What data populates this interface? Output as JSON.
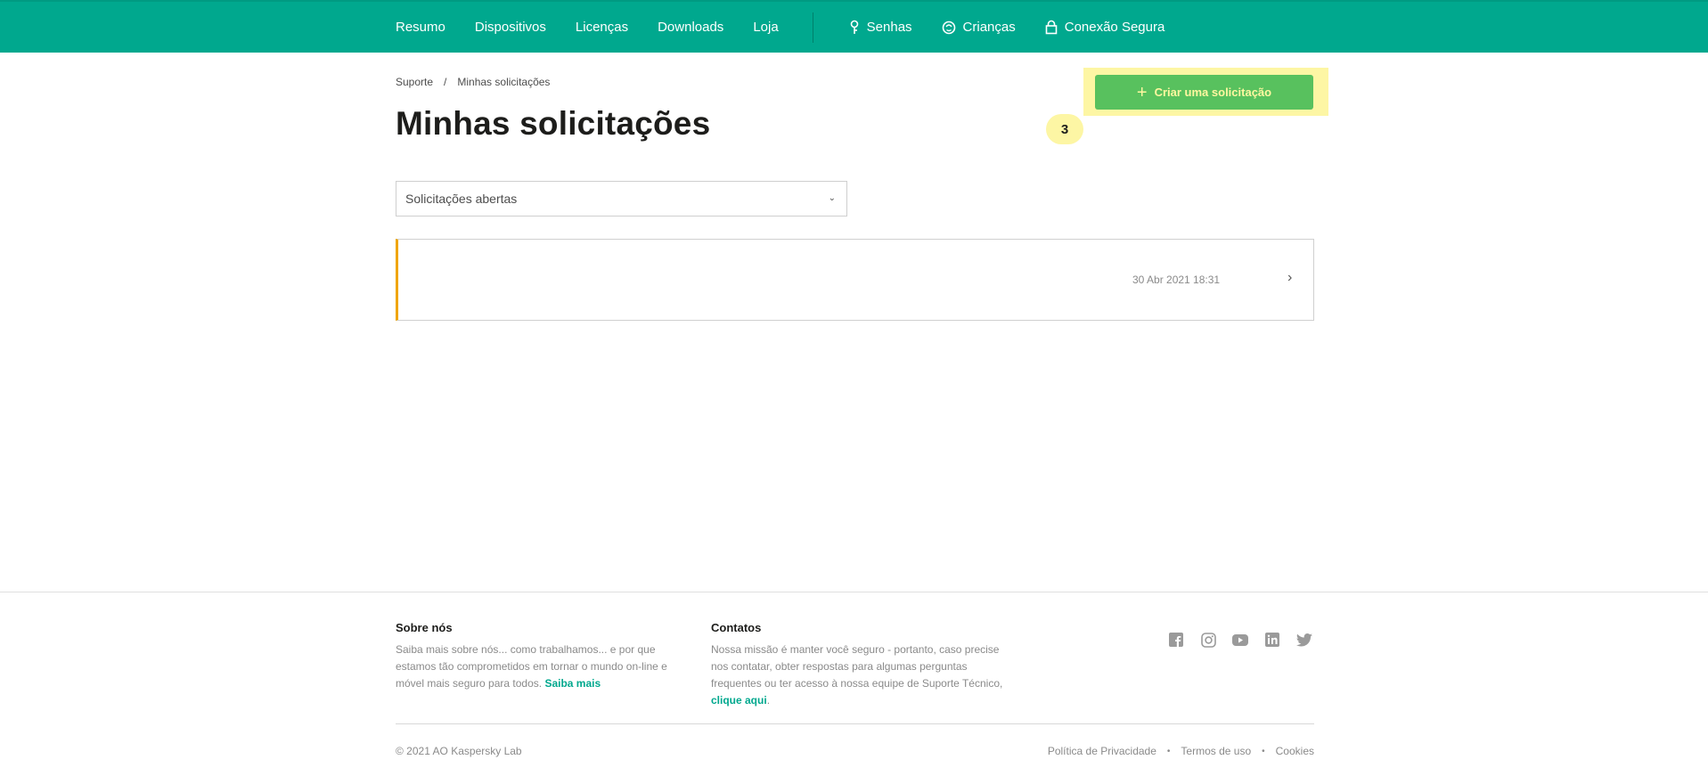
{
  "nav": {
    "main_items": [
      "Resumo",
      "Dispositivos",
      "Licenças",
      "Downloads",
      "Loja"
    ],
    "ext_items": [
      {
        "label": "Senhas",
        "icon": "key-icon"
      },
      {
        "label": "Crianças",
        "icon": "kids-icon"
      },
      {
        "label": "Conexão Segura",
        "icon": "lock-icon"
      }
    ]
  },
  "breadcrumb": {
    "root": "Suporte",
    "separator": "/",
    "current": "Minhas solicitações"
  },
  "page": {
    "title": "Minhas solicitações",
    "create_button": "Criar uma solicitação",
    "step_badge": "3"
  },
  "filter": {
    "selected": "Solicitações abertas"
  },
  "requests": [
    {
      "date": "30 Abr 2021 18:31",
      "status_color": "#f0a500"
    }
  ],
  "footer": {
    "about": {
      "title": "Sobre nós",
      "text": "Saiba mais sobre nós... como trabalhamos... e por que estamos tão comprometidos em tornar o mundo on-line e móvel mais seguro para todos.",
      "link": "Saiba mais"
    },
    "contacts": {
      "title": "Contatos",
      "text": "Nossa missão é manter você seguro - portanto, caso precise nos contatar, obter respostas para algumas perguntas frequentes ou ter acesso à nossa equipe de Suporte Técnico,",
      "link": "clique aqui",
      "suffix": "."
    },
    "social": [
      "facebook-icon",
      "instagram-icon",
      "youtube-icon",
      "linkedin-icon",
      "twitter-icon"
    ],
    "copyright": "© 2021 AO Kaspersky Lab",
    "legal": [
      "Política de Privacidade",
      "Termos de uso",
      "Cookies"
    ]
  },
  "colors": {
    "brand": "#00a88e",
    "cta": "#58c15e",
    "highlight": "#fdf6a4"
  }
}
